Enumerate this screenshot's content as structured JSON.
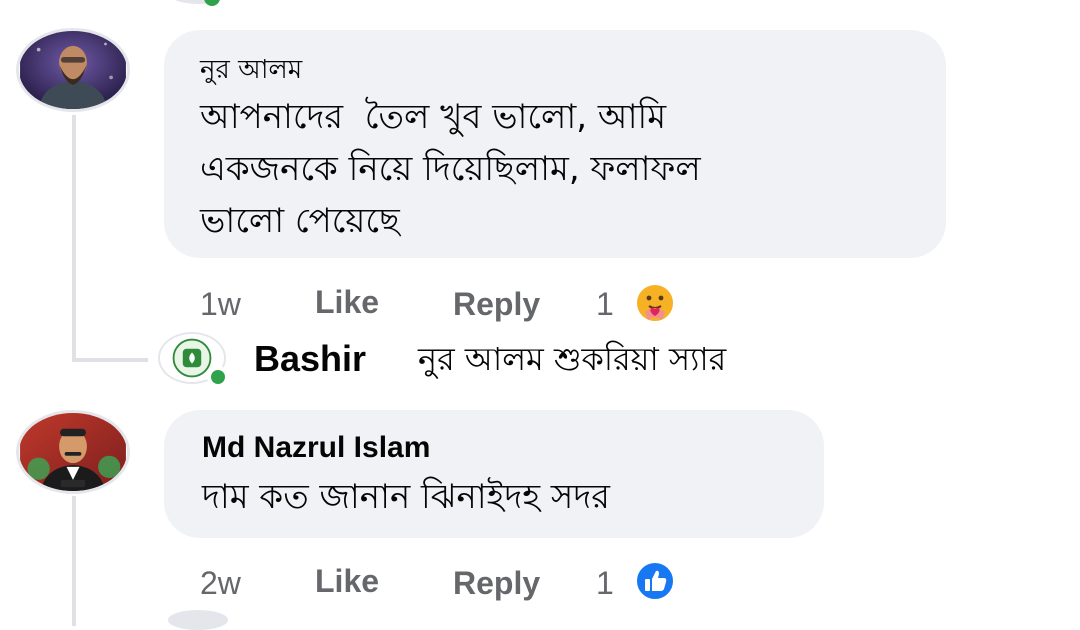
{
  "comments": [
    {
      "author": "নুর আলম",
      "text_lines": [
        "আপনাদের  তৈল খুব ভালো, আমি",
        "একজনকে নিয়ে দিয়েছিলাম, ফলাফল",
        "ভালো পেয়েছে"
      ],
      "time": "1w",
      "like_label": "Like",
      "reply_label": "Reply",
      "reaction_count": "1",
      "reaction_icon": "care-emoji-icon",
      "reply": {
        "author": "Bashir",
        "text": "নুর আলম শুকরিয়া স্যার"
      }
    },
    {
      "author": "Md Nazrul Islam",
      "text_lines": [
        "দাম কত জানান ঝিনাইদহ সদর"
      ],
      "time": "2w",
      "like_label": "Like",
      "reply_label": "Reply",
      "reaction_count": "1",
      "reaction_icon": "like-thumb-icon"
    }
  ],
  "colors": {
    "bubble_bg": "#f0f2f5",
    "meta_text": "#65676b",
    "online": "#31a24c",
    "like_blue": "#1877f2"
  }
}
